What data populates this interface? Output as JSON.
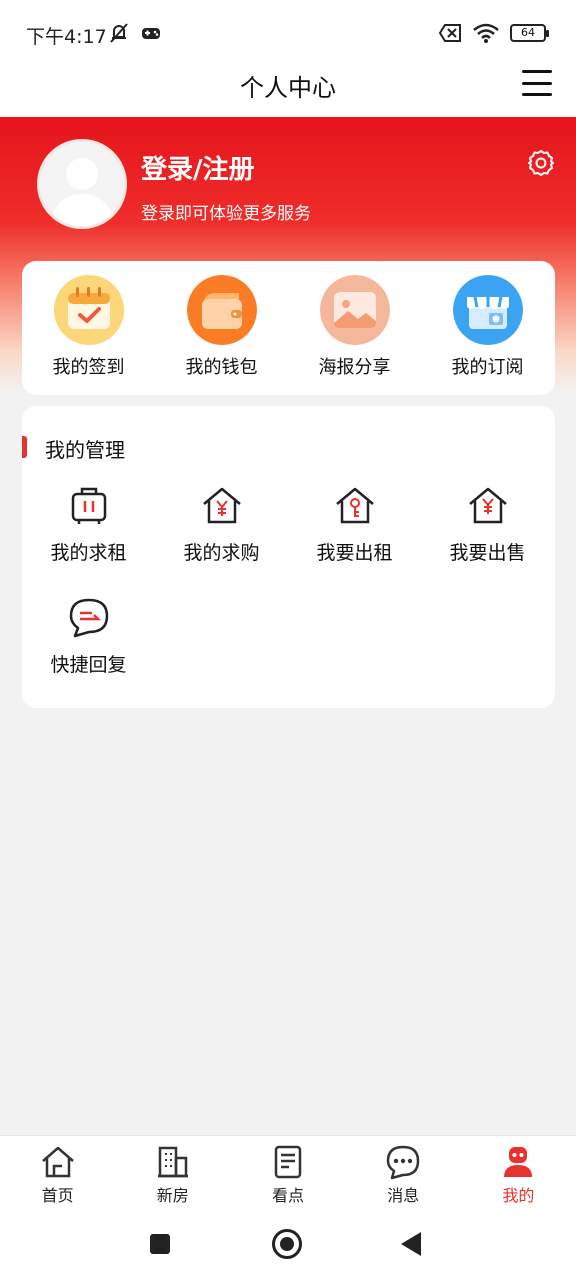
{
  "status_bar": {
    "time": "下午4:17",
    "battery": "64"
  },
  "header": {
    "title": "个人中心"
  },
  "profile": {
    "login_text": "登录/注册",
    "subtitle": "登录即可体验更多服务"
  },
  "quick_actions": [
    {
      "label": "我的签到",
      "icon": "calendar-check-icon"
    },
    {
      "label": "我的钱包",
      "icon": "wallet-icon"
    },
    {
      "label": "海报分享",
      "icon": "poster-image-icon"
    },
    {
      "label": "我的订阅",
      "icon": "store-subscribe-icon"
    }
  ],
  "management": {
    "title": "我的管理",
    "items": [
      {
        "label": "我的求租",
        "icon": "suitcase-icon"
      },
      {
        "label": "我的求购",
        "icon": "house-yen-icon"
      },
      {
        "label": "我要出租",
        "icon": "house-key-icon"
      },
      {
        "label": "我要出售",
        "icon": "house-yen-icon"
      },
      {
        "label": "快捷回复",
        "icon": "chat-reply-icon"
      }
    ]
  },
  "bottom_nav": [
    {
      "label": "首页",
      "icon": "home-icon"
    },
    {
      "label": "新房",
      "icon": "building-icon"
    },
    {
      "label": "看点",
      "icon": "news-icon"
    },
    {
      "label": "消息",
      "icon": "message-icon"
    },
    {
      "label": "我的",
      "icon": "profile-icon",
      "active": true
    }
  ],
  "colors": {
    "accent": "#e8322f",
    "header_red": "#e5141b",
    "background": "#f2f2f2"
  }
}
